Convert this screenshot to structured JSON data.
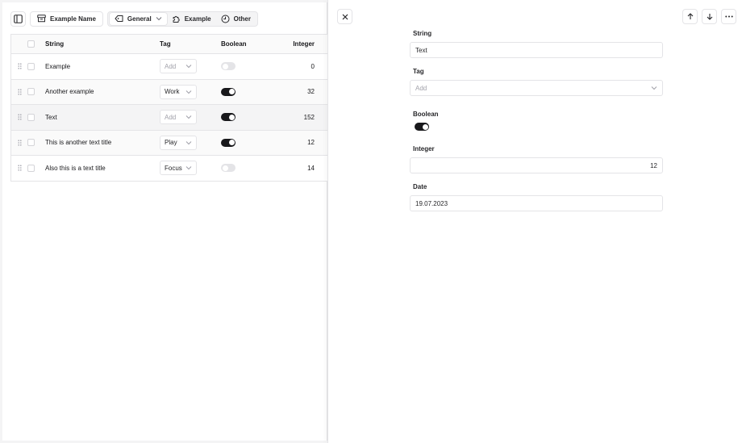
{
  "toolbar": {
    "view_button": "Example Name",
    "filter_button": "General",
    "group": [
      {
        "label": "Example",
        "icon": "puzzle-icon",
        "active": true
      },
      {
        "label": "Other",
        "icon": "clock-icon",
        "active": false
      }
    ]
  },
  "table": {
    "headers": {
      "string": "String",
      "tag": "Tag",
      "boolean": "Boolean",
      "integer": "Integer"
    },
    "rows": [
      {
        "string": "Example",
        "tag": "Add",
        "tag_empty": true,
        "boolean": false,
        "integer": "0"
      },
      {
        "string": "Another example",
        "tag": "Work",
        "tag_empty": false,
        "boolean": true,
        "integer": "32"
      },
      {
        "string": "Text",
        "tag": "Add",
        "tag_empty": true,
        "boolean": true,
        "integer": "152"
      },
      {
        "string": "This is another text title",
        "tag": "Play",
        "tag_empty": false,
        "boolean": true,
        "integer": "12"
      },
      {
        "string": "Also this is a text title",
        "tag": "Focus",
        "tag_empty": false,
        "boolean": false,
        "integer": "14"
      }
    ]
  },
  "detail": {
    "fields": {
      "string": {
        "label": "String",
        "value": "Text"
      },
      "tag": {
        "label": "Tag",
        "placeholder": "Add"
      },
      "boolean": {
        "label": "Boolean",
        "value": true
      },
      "integer": {
        "label": "Integer",
        "value": "12"
      },
      "date": {
        "label": "Date",
        "value": "19.07.2023"
      }
    }
  }
}
